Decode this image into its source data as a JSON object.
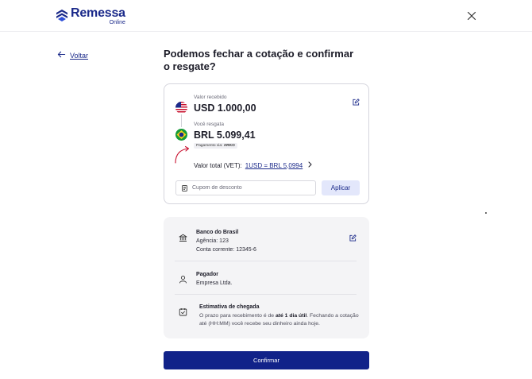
{
  "header": {
    "brand_name": "Remessa",
    "brand_sub": "Online"
  },
  "nav": {
    "back_label": "Voltar"
  },
  "page": {
    "title": "Podemos fechar a cotação e confirmar o resgate?"
  },
  "quote": {
    "received_label": "Valor recebido",
    "received_amount": "USD 1.000,00",
    "redeem_label": "Você resgata",
    "redeem_amount": "BRL 5.099,41",
    "payment_via_label": "Pagamento via:",
    "payment_via_value": "ARKO",
    "vet_label": "Valor total (VET):",
    "vet_rate": "1USD = BRL 5,0994",
    "coupon_placeholder": "Cupom de desconto",
    "apply_label": "Aplicar"
  },
  "bank": {
    "name": "Banco do Brasil",
    "agency": "Agência: 123",
    "account": "Conta corrente: 12345-6"
  },
  "payer": {
    "title": "Pagador",
    "name": "Empresa Ltda."
  },
  "eta": {
    "title": "Estimativa de chegada",
    "desc_prefix": "O prazo para recebimento é de ",
    "desc_bold": "até 1 dia útil",
    "desc_suffix": ". Fechando a cotação até (HH:MM) você recebe seu dinheiro ainda hoje."
  },
  "actions": {
    "confirm_label": "Confirmar"
  },
  "colors": {
    "brand": "#1b2a8a",
    "confirm": "#112289",
    "apply_bg": "#e3e7fb",
    "info_bg": "#f4f4f6",
    "accent_red": "#c8102e"
  },
  "icons": {
    "logo": "remessa-logo-icon",
    "close": "close-icon",
    "back": "arrow-left-icon",
    "edit": "pencil-icon",
    "coupon": "receipt-icon",
    "bank": "bank-icon",
    "payer": "user-icon",
    "eta": "calendar-check-icon",
    "chevron": "chevron-right-icon"
  }
}
